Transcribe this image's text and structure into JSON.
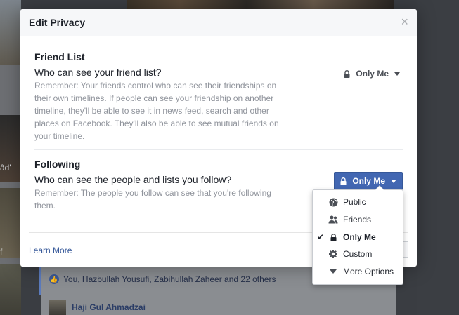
{
  "background": {
    "left_text_1": "âd'",
    "left_text_2": "f",
    "feed_likes": "You, Hazbullah Yousufi, Zabihullah Zaheer and 22 others",
    "feed_comment_author": "Haji Gul Ahmadzai"
  },
  "modal": {
    "title": "Edit Privacy",
    "close_icon": "close-icon",
    "friend_list": {
      "title": "Friend List",
      "question": "Who can see your friend list?",
      "note": "Remember: Your friends control who can see their friendships on their own timelines. If people can see your friendship on another timeline, they'll be able to see it in news feed, search and other places on Facebook. They'll also be able to see mutual friends on your timeline.",
      "audience": "Only Me"
    },
    "following": {
      "title": "Following",
      "question": "Who can see the people and lists you follow?",
      "note": "Remember: The people you follow can see that you're following them.",
      "audience": "Only Me"
    },
    "learn_more": "Learn More"
  },
  "audience_menu": {
    "items": [
      {
        "label": "Public",
        "icon": "globe-icon",
        "selected": false
      },
      {
        "label": "Friends",
        "icon": "friends-icon",
        "selected": false
      },
      {
        "label": "Only Me",
        "icon": "lock-icon",
        "selected": true
      },
      {
        "label": "Custom",
        "icon": "gear-icon",
        "selected": false
      },
      {
        "label": "More Options",
        "icon": "caret-down-icon",
        "selected": false
      }
    ]
  },
  "colors": {
    "accent": "#4267b2",
    "link": "#365899",
    "muted_text": "#90949c"
  }
}
